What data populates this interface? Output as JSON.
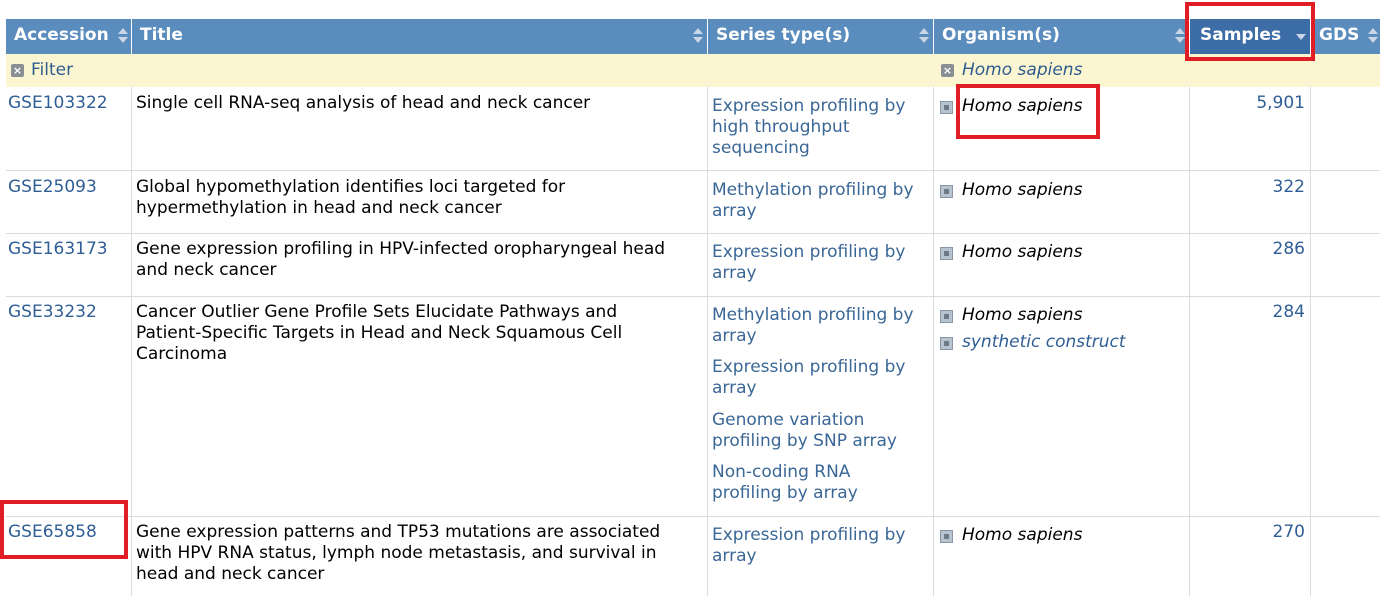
{
  "table": {
    "headers": {
      "accession": "Accession",
      "title": "Title",
      "series_type": "Series type(s)",
      "organism": "Organism(s)",
      "samples": "Samples",
      "gds": "GDS"
    },
    "filter": {
      "label": "Filter",
      "organism_value": "Homo sapiens"
    },
    "rows": [
      {
        "accession": "GSE103322",
        "title_lines": [
          "Single cell RNA-seq analysis of head and neck cancer"
        ],
        "series_types": [
          [
            "Expression profiling by",
            "high throughput",
            "sequencing"
          ]
        ],
        "organisms": [
          {
            "name": "Homo sapiens",
            "link": false
          }
        ],
        "samples": "5,901"
      },
      {
        "accession": "GSE25093",
        "title_lines": [
          "Global hypomethylation identifies loci targeted for",
          "hypermethylation in head and neck cancer"
        ],
        "series_types": [
          [
            "Methylation profiling by",
            "array"
          ]
        ],
        "organisms": [
          {
            "name": "Homo sapiens",
            "link": false
          }
        ],
        "samples": "322"
      },
      {
        "accession": "GSE163173",
        "title_lines": [
          "Gene expression profiling in HPV-infected oropharyngeal head",
          "and neck cancer"
        ],
        "series_types": [
          [
            "Expression profiling by",
            "array"
          ]
        ],
        "organisms": [
          {
            "name": "Homo sapiens",
            "link": false
          }
        ],
        "samples": "286"
      },
      {
        "accession": "GSE33232",
        "title_lines": [
          "Cancer Outlier Gene Profile Sets Elucidate Pathways and",
          "Patient-Specific Targets in Head and Neck Squamous Cell",
          "Carcinoma"
        ],
        "series_types": [
          [
            "Methylation profiling by",
            "array"
          ],
          [
            "Expression profiling by",
            "array"
          ],
          [
            "Genome variation",
            "profiling by SNP array"
          ],
          [
            "Non-coding RNA",
            "profiling by array"
          ]
        ],
        "organisms": [
          {
            "name": "Homo sapiens",
            "link": false
          },
          {
            "name": "synthetic construct",
            "link": true
          }
        ],
        "samples": "284"
      },
      {
        "accession": "GSE65858",
        "title_lines": [
          "Gene expression patterns and TP53 mutations are associated",
          "with HPV RNA status, lymph node metastasis, and survival in",
          "head and neck cancer"
        ],
        "series_types": [
          [
            "Expression profiling by",
            "array"
          ]
        ],
        "organisms": [
          {
            "name": "Homo sapiens",
            "link": false
          }
        ],
        "samples": "270"
      }
    ]
  },
  "colors": {
    "header_bg": "#5a8cbe",
    "header_sorted_bg": "#3d6da6",
    "filter_bg": "#fbf5d2",
    "link": "#2f5e95",
    "highlight_box": "#e01c24"
  }
}
